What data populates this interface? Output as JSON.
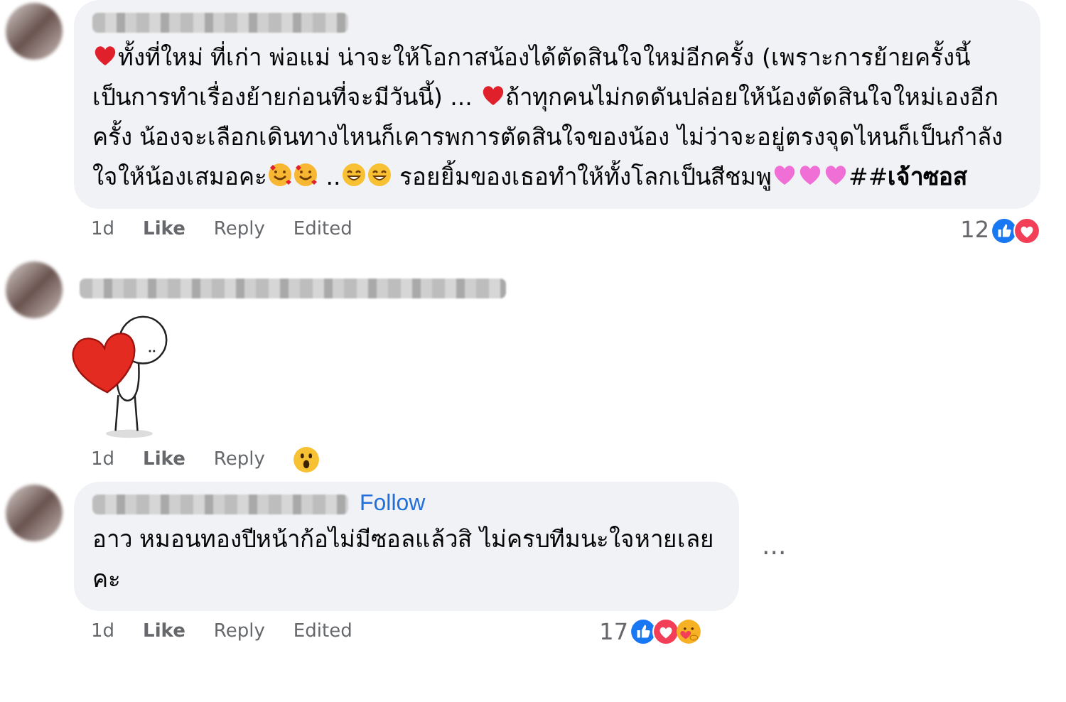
{
  "comments": [
    {
      "kind": "text",
      "body": [
        {
          "kind": "heart"
        },
        {
          "kind": "text",
          "text": "ทั้งที่ใหม่ ที่เก่า พ่อแม่ น่าจะให้โอกาสน้องได้ตัดสินใจใหม่อีกครั้ง (เพราะการย้ายครั้งนี้เป็นการทำเรื่องย้ายก่อนที่จะมีวันนี้) ... "
        },
        {
          "kind": "heart"
        },
        {
          "kind": "text",
          "text": "ถ้าทุกคนไม่กดดันปล่อยให้น้องตัดสินใจใหม่เองอีกครั้ง น้องจะเลือกเดินทางไหนก็เคารพการตัดสินใจของน้อง ไม่ว่าจะอยู่ตรงจุดไหนก็เป็นกำลังใจให้น้องเสมอคะ"
        },
        {
          "kind": "love"
        },
        {
          "kind": "love"
        },
        {
          "kind": "text",
          "text": " .."
        },
        {
          "kind": "grin"
        },
        {
          "kind": "grin"
        },
        {
          "kind": "text",
          "text": " รอยยิ้มของเธอทำให้ทั้งโลกเป็นสีชมพู"
        },
        {
          "kind": "pink"
        },
        {
          "kind": "pink"
        },
        {
          "kind": "pink"
        },
        {
          "kind": "text",
          "text": "##**เจ้าซอส**"
        }
      ],
      "time": "1d",
      "like": "Like",
      "reply": "Reply",
      "edited": "Edited",
      "reaction_count": "12",
      "reactions": [
        {
          "kind": "like"
        },
        {
          "kind": "love"
        }
      ]
    },
    {
      "kind": "sticker",
      "time": "1d",
      "like": "Like",
      "reply": "Reply",
      "reactions": [
        {
          "kind": "wow"
        }
      ]
    },
    {
      "kind": "text",
      "follow": "Follow",
      "body": [
        {
          "kind": "text",
          "text": "อาว หมอนทองปีหน้าก้อไม่มีซอลแล้วสิ ไม่ครบทีมนะใจหายเลยคะ"
        }
      ],
      "more": "...",
      "time": "1d",
      "like": "Like",
      "reply": "Reply",
      "edited": "Edited",
      "reaction_count": "17",
      "reactions": [
        {
          "kind": "like"
        },
        {
          "kind": "love"
        },
        {
          "kind": "care"
        }
      ]
    }
  ]
}
